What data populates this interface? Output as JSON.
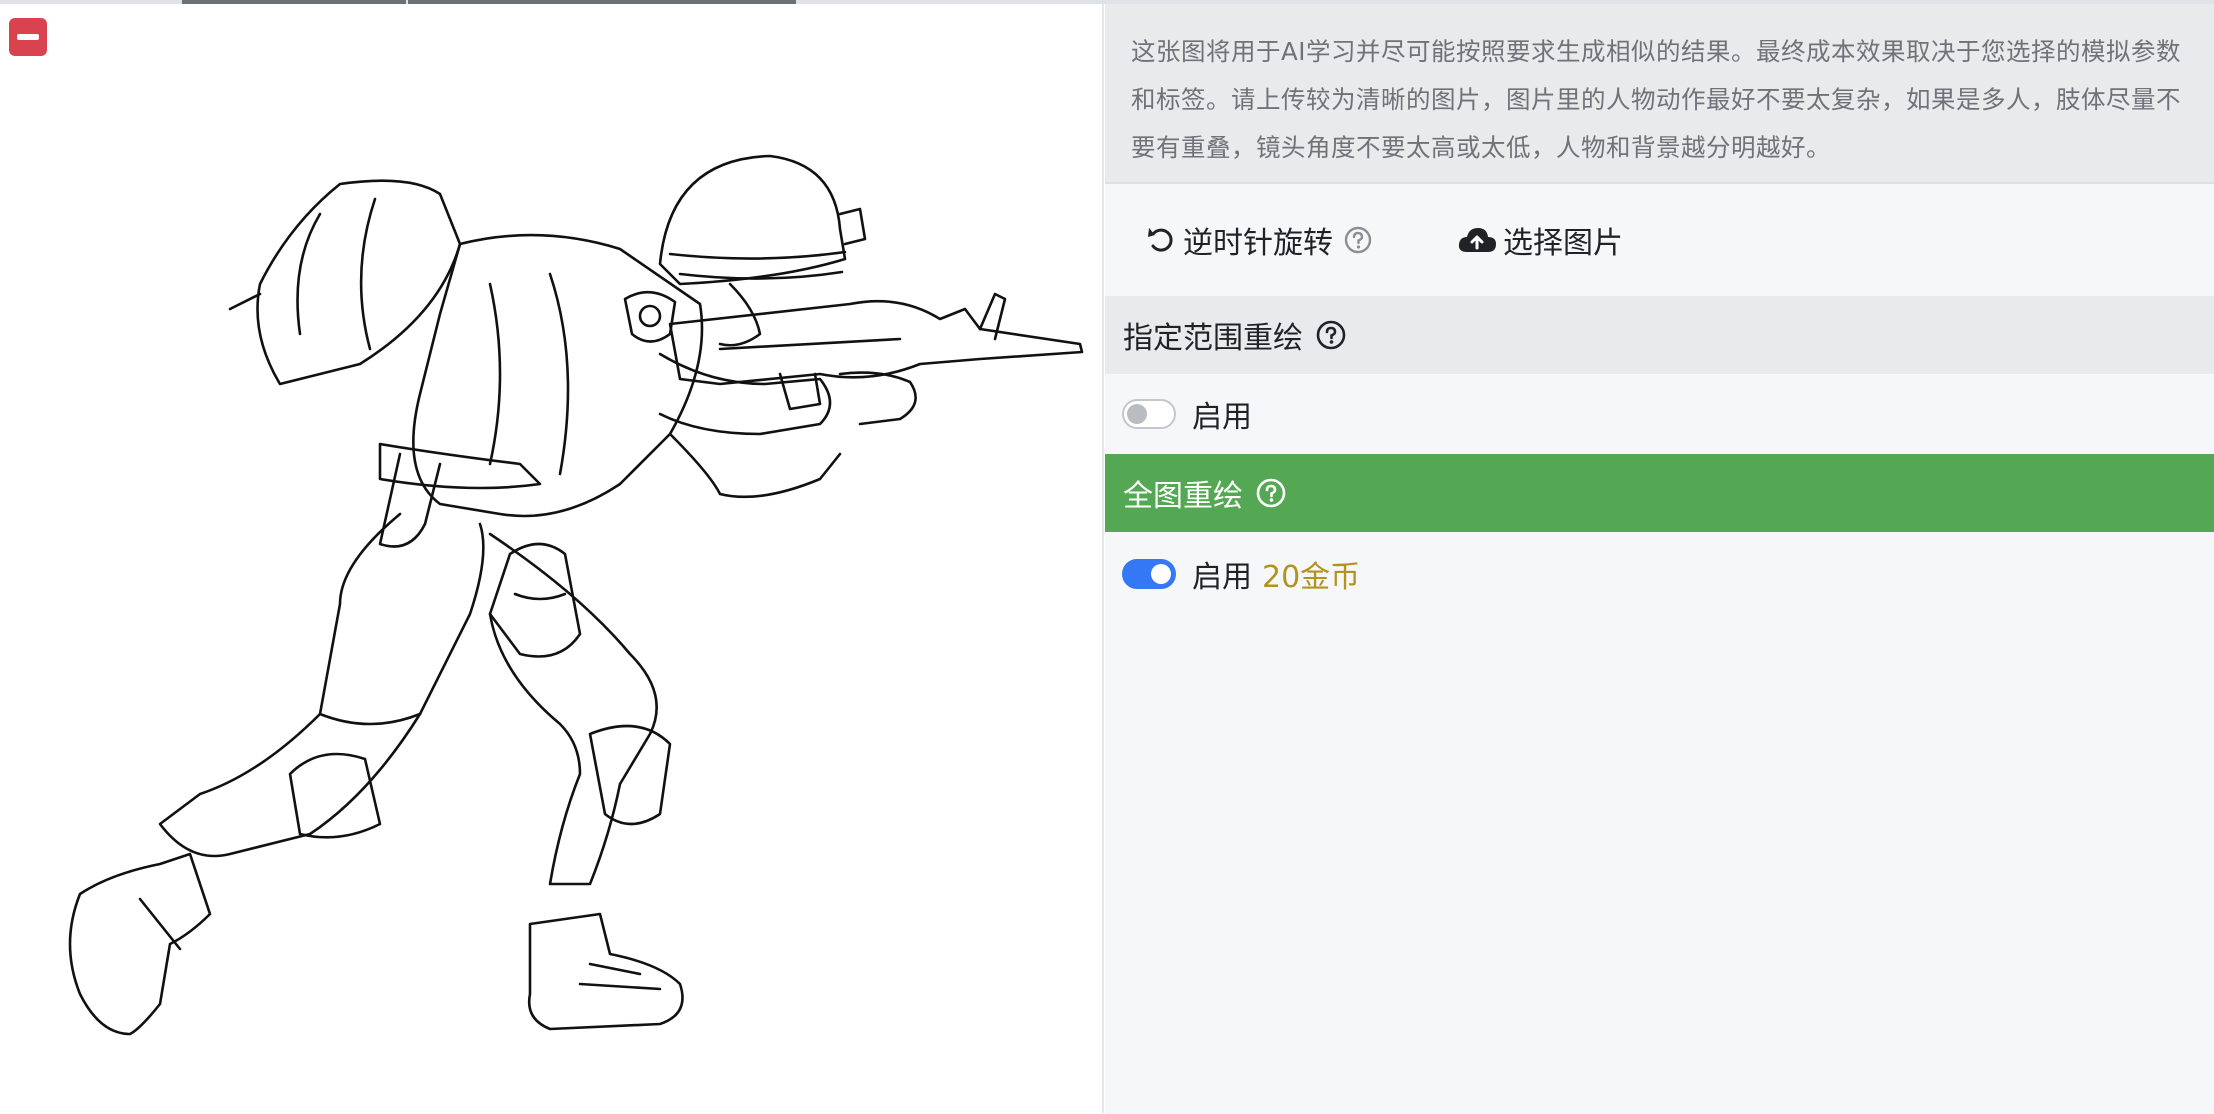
{
  "colors": {
    "accent_blue": "#3478f6",
    "success_green": "#55a853",
    "danger_red": "#d9434f",
    "cost_gold": "#b3921f",
    "notice_bg": "#e9eaeb"
  },
  "image_panel": {
    "remove_icon": "minus-square-icon",
    "image_subject": "line-drawing-soldier"
  },
  "notice": {
    "text": "这张图将用于AI学习并尽可能按照要求生成相似的结果。最终成本效果取决于您选择的模拟参数和标签。请上传较为清晰的图片，图片里的人物动作最好不要太复杂，如果是多人，肢体尽量不要有重叠，镜头角度不要太高或太低，人物和背景越分明越好。"
  },
  "toolbar": {
    "rotate_label": "逆时针旋转",
    "rotate_icon": "rotate-ccw-icon",
    "rotate_help_icon": "question-circle-icon",
    "upload_label": "选择图片",
    "upload_icon": "cloud-upload-icon"
  },
  "sections": {
    "region_redraw": {
      "title": "指定范围重绘",
      "toggle_label": "启用",
      "enabled": false
    },
    "full_redraw": {
      "title": "全图重绘",
      "toggle_label": "启用",
      "cost": "20金币",
      "enabled": true
    }
  }
}
